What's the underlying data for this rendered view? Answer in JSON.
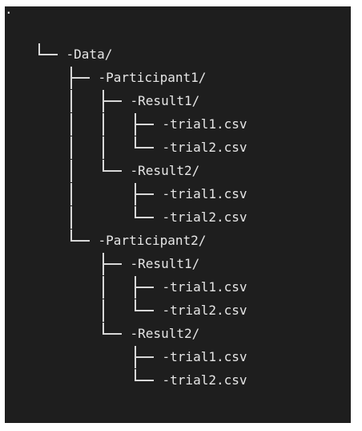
{
  "tree": {
    "root": ".",
    "nodes": [
      {
        "label": "-Data/"
      },
      {
        "label": "-Participant1/"
      },
      {
        "label": "-Result1/"
      },
      {
        "label": "-trial1.csv"
      },
      {
        "label": "-trial2.csv"
      },
      {
        "label": "-Result2/"
      },
      {
        "label": "-trial1.csv"
      },
      {
        "label": "-trial2.csv"
      },
      {
        "label": "-Participant2/"
      },
      {
        "label": "-Result1/"
      },
      {
        "label": "-trial1.csv"
      },
      {
        "label": "-trial2.csv"
      },
      {
        "label": "-Result2/"
      },
      {
        "label": "-trial1.csv"
      },
      {
        "label": "-trial2.csv"
      }
    ]
  }
}
